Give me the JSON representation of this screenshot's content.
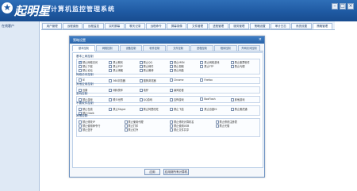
{
  "header": {
    "brand": "起明星",
    "app_title": "计算机监控管理系统",
    "logo_icon": "star-icon"
  },
  "sidebar": {
    "item": "在线客户"
  },
  "tabs": [
    "用户管理",
    "远程桌面",
    "远程监控",
    "实时屏幕",
    "聊天记录",
    "远程命令",
    "屏幕录像",
    "文件管理",
    "进程管理",
    "服务管理",
    "策略设置",
    "审计日志",
    "系统设置",
    "策略管理"
  ],
  "dialog": {
    "title": "策略设置",
    "tabs": [
      "基本控制",
      "网络控制",
      "设备控制",
      "软件控制",
      "文件控制",
      "进程控制",
      "程序控制",
      "外网访问控制"
    ],
    "groups": [
      {
        "title": "基本上网控制",
        "options": [
          {
            "label": "禁止网络访问",
            "checked": true
          },
          {
            "label": "禁止聊天",
            "checked": false
          },
          {
            "label": "禁止QQ",
            "checked": false
          },
          {
            "label": "禁止MSN",
            "checked": false
          },
          {
            "label": "禁止网络游戏",
            "checked": false
          },
          {
            "label": "禁止股票软件",
            "checked": false
          },
          {
            "label": "禁止下载",
            "checked": false
          },
          {
            "label": "禁止P2P",
            "checked": false
          },
          {
            "label": "禁止邮件",
            "checked": false
          },
          {
            "label": "禁止视频",
            "checked": false
          },
          {
            "label": "禁止FTP",
            "checked": false
          },
          {
            "label": "禁止代理",
            "checked": false
          },
          {
            "label": "禁止论坛",
            "checked": false
          },
          {
            "label": "禁止博客",
            "checked": false
          },
          {
            "label": "禁止微博",
            "checked": false
          },
          {
            "label": "禁止网盘",
            "checked": false
          }
        ]
      },
      {
        "title": "网络访问控制",
        "options": [
          {
            "label": "IE",
            "checked": false
          },
          {
            "label": "360浏览器",
            "checked": false
          },
          {
            "label": "搜狗浏览器",
            "checked": false
          },
          {
            "label": "Chrome",
            "checked": false
          },
          {
            "label": "Firefox",
            "checked": false
          }
        ]
      },
      {
        "title": "其他应用控制",
        "options": [
          {
            "label": "迅雷",
            "checked": false
          },
          {
            "label": "网际快车",
            "checked": false
          },
          {
            "label": "电驴",
            "checked": false
          },
          {
            "label": "暴风影音",
            "checked": false
          }
        ]
      },
      {
        "title": "游戏控制",
        "options": [
          {
            "label": "禁止游戏",
            "checked": false
          },
          {
            "label": "联众世界",
            "checked": false
          },
          {
            "label": "QQ游戏",
            "checked": false
          },
          {
            "label": "边锋游戏",
            "checked": false
          },
          {
            "label": "BoxFlash",
            "checked": false
          },
          {
            "label": "其他游戏",
            "checked": false
          }
        ]
      },
      {
        "title": "不要软件控制",
        "options": [
          {
            "label": "禁止在线",
            "checked": false
          },
          {
            "label": "禁止Skype",
            "checked": false
          },
          {
            "label": "禁止阿里旺旺",
            "checked": false
          },
          {
            "label": "禁止飞信",
            "checked": false
          },
          {
            "label": "禁止百度Hi",
            "checked": false
          },
          {
            "label": "禁止雅虎通",
            "checked": false
          },
          {
            "label": "禁止Gtalk",
            "checked": false
          }
        ]
      },
      {
        "title": "其他控制",
        "options": [
          {
            "label": "禁止修改IP",
            "checked": false
          },
          {
            "label": "禁止使用代理",
            "checked": false
          },
          {
            "label": "禁止修改计算机名",
            "checked": false
          },
          {
            "label": "禁止修改注册表",
            "checked": false
          },
          {
            "label": "禁止使用命令行",
            "checked": false
          },
          {
            "label": "禁止打印",
            "checked": false
          },
          {
            "label": "禁止使用USB",
            "checked": false
          },
          {
            "label": "禁止光驱",
            "checked": false
          },
          {
            "label": "禁止蓝牙",
            "checked": false
          },
          {
            "label": "禁止红外",
            "checked": false
          },
          {
            "label": "禁止文件共享",
            "checked": false
          }
        ]
      }
    ],
    "ok_label": "应用",
    "save_label": "应用到所有计算机"
  }
}
